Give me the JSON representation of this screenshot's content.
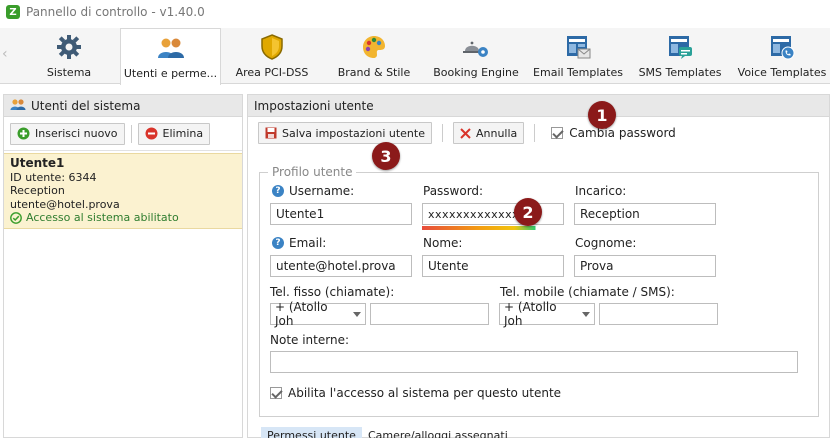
{
  "window": {
    "title": "Pannello di controllo - v1.40.0"
  },
  "ribbon": {
    "tabs": [
      {
        "label": "Sistema",
        "icon": "gear-icon"
      },
      {
        "label": "Utenti e perme...",
        "icon": "users-icon",
        "active": true
      },
      {
        "label": "Area PCI-DSS",
        "icon": "shield-icon"
      },
      {
        "label": "Brand & Stile",
        "icon": "palette-icon"
      },
      {
        "label": "Booking Engine",
        "icon": "booking-bell-icon"
      },
      {
        "label": "Email Templates",
        "icon": "email-template-icon"
      },
      {
        "label": "SMS Templates",
        "icon": "sms-template-icon"
      },
      {
        "label": "Voice Templates",
        "icon": "voice-template-icon"
      }
    ]
  },
  "left_panel": {
    "title": "Utenti del sistema",
    "insert_label": "Inserisci nuovo",
    "delete_label": "Elimina",
    "users": [
      {
        "name": "Utente1",
        "id_line": "ID utente: 6344",
        "role": "Reception",
        "email": "utente@hotel.prova",
        "access": "Accesso al sistema abilitato"
      }
    ]
  },
  "right_panel": {
    "title": "Impostazioni utente",
    "save_label": "Salva impostazioni utente",
    "cancel_label": "Annulla",
    "change_password_label": "Cambia password",
    "profile": {
      "legend": "Profilo utente",
      "username_label": "Username:",
      "username_value": "Utente1",
      "password_label": "Password:",
      "password_value": "xxxxxxxxxxxxxx",
      "password_strength": 0.8,
      "role_label": "Incarico:",
      "role_value": "Reception",
      "email_label": "Email:",
      "email_value": "utente@hotel.prova",
      "name_label": "Nome:",
      "name_value": "Utente",
      "surname_label": "Cognome:",
      "surname_value": "Prova",
      "landline_label": "Tel. fisso (chiamate):",
      "landline_prefix": "+ (Atollo Joh",
      "landline_value": "",
      "mobile_label": "Tel. mobile (chiamate / SMS):",
      "mobile_prefix": "+ (Atollo Joh",
      "mobile_value": "",
      "notes_label": "Note interne:",
      "notes_value": "",
      "enable_access_label": "Abilita l'accesso al sistema per questo utente"
    },
    "bottom_tabs": [
      "Permessi utente",
      "Camere/alloggi assegnati"
    ]
  },
  "annotations": [
    "1",
    "2",
    "3"
  ],
  "colors": {
    "badge": "#8b1a1a",
    "selected_row": "#fbf2d0",
    "accent_blue": "#3b83c4"
  }
}
